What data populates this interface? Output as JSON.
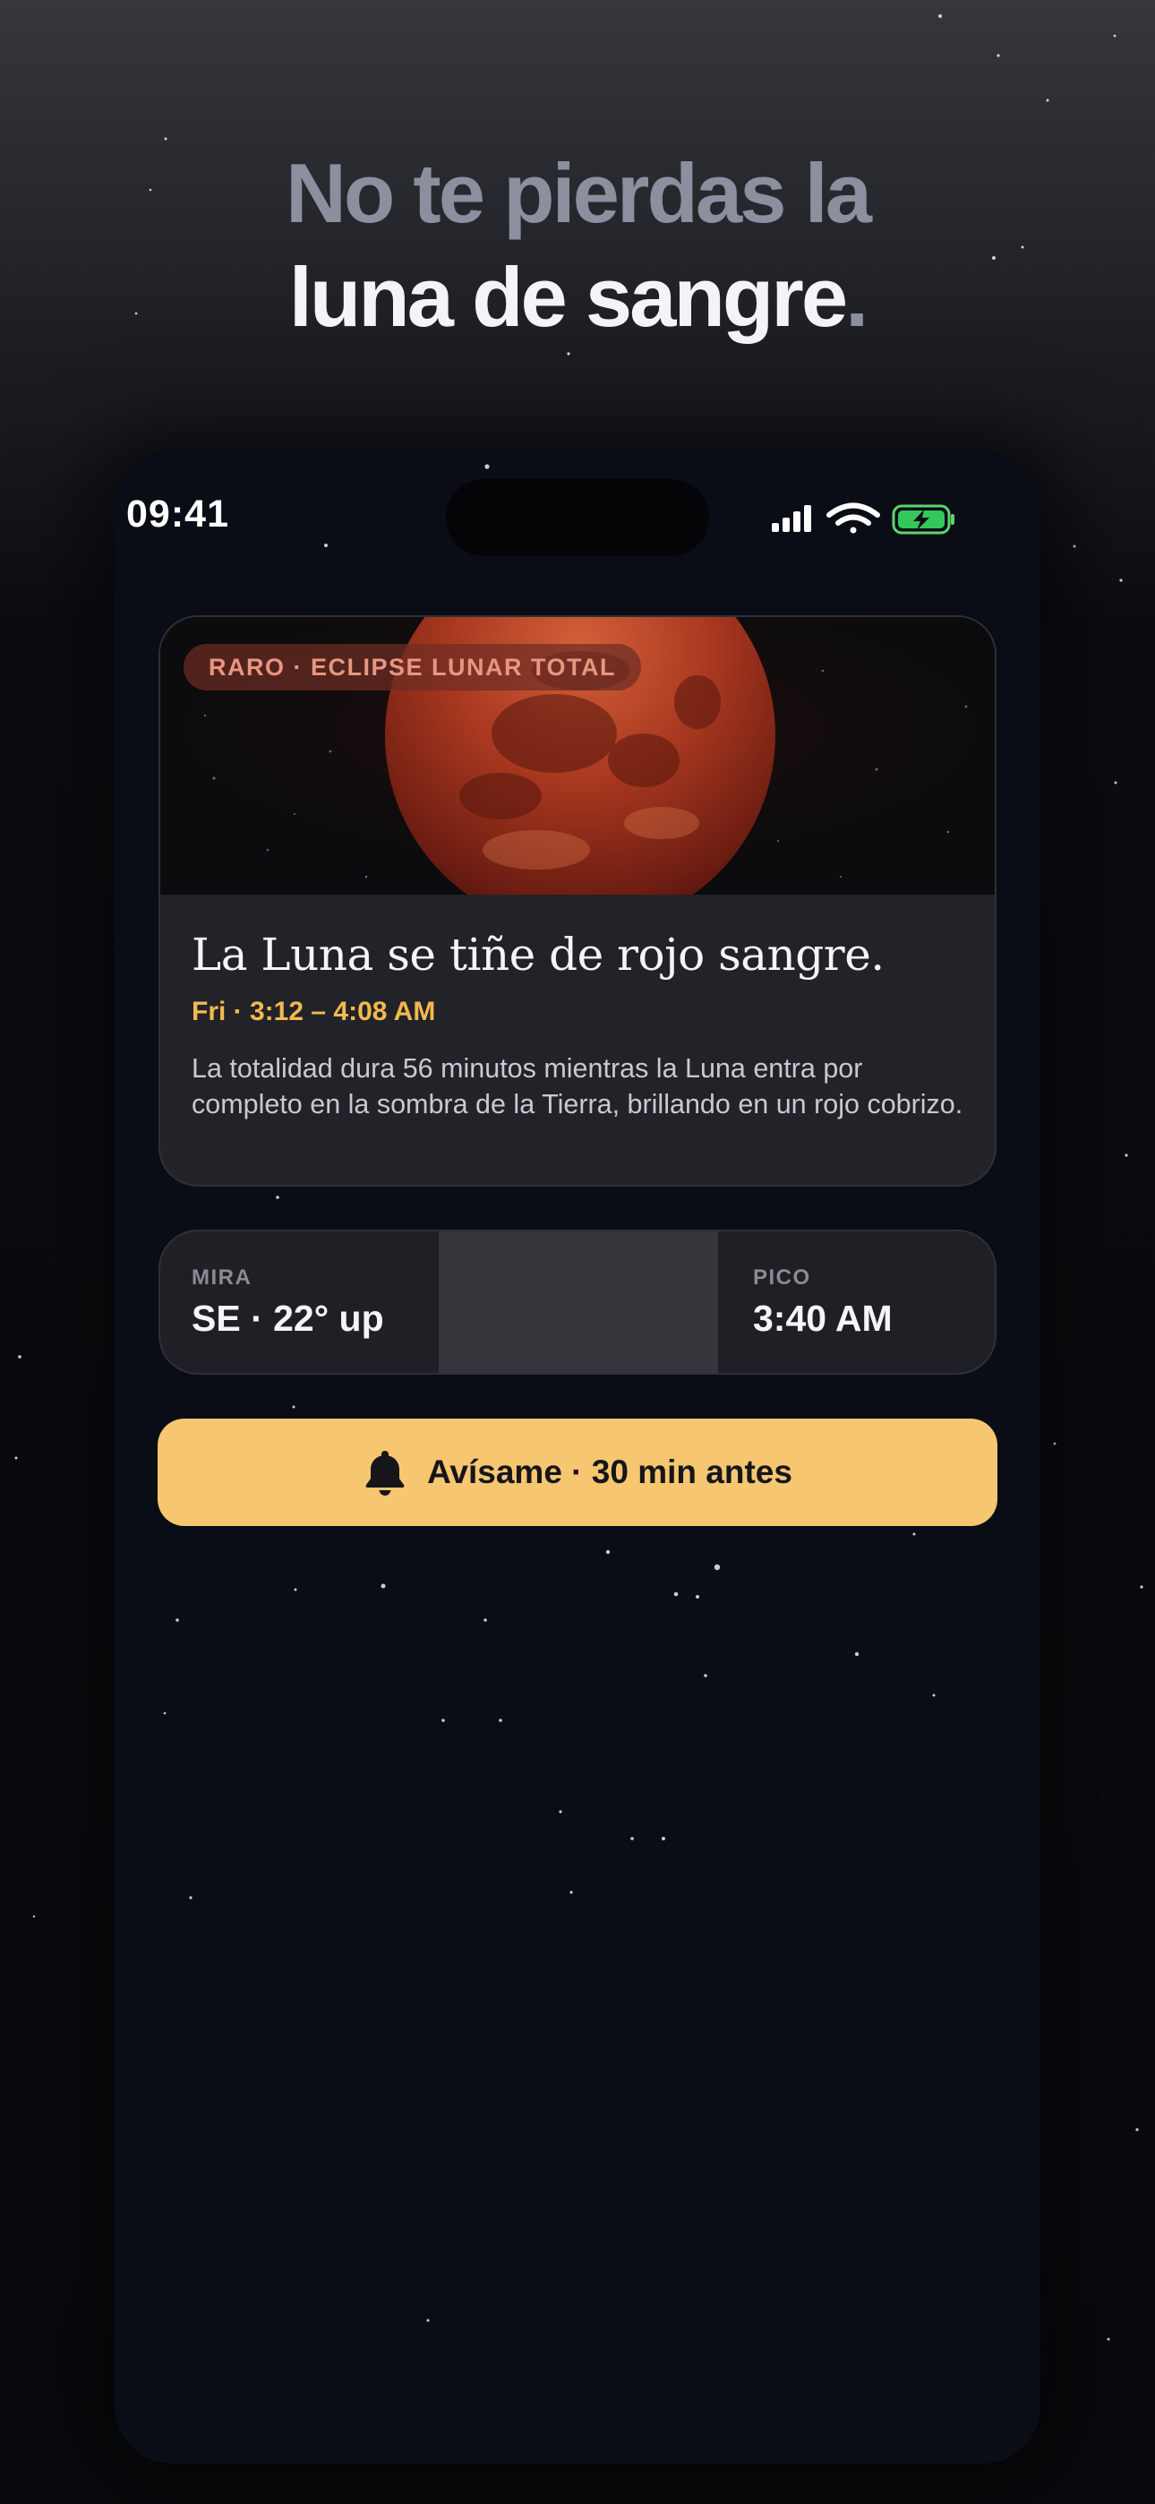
{
  "headline": {
    "line1": "No te pierdas la",
    "line2": "luna de sangre",
    "punctuation": "."
  },
  "status_bar": {
    "time": "09:41",
    "icons": [
      "signal-icon",
      "wifi-icon",
      "battery-charging-icon"
    ]
  },
  "event_card": {
    "badge": "RARO · ECLIPSE LUNAR TOTAL",
    "title": "La Luna se tiñe de rojo sangre.",
    "time": "Fri · 3:12 – 4:08 AM",
    "description": "La totalidad dura 56 minutos mientras la Luna entra por completo en la sombra de la Tierra, brillando en un rojo cobrizo."
  },
  "stats": {
    "look": {
      "label": "MIRA",
      "value": "SE · 22° up"
    },
    "peak": {
      "label": "PICO",
      "value": "3:40 AM"
    }
  },
  "cta": {
    "icon": "bell-icon",
    "label": "Avísame · 30 min antes"
  },
  "colors": {
    "accent": "#f6c670",
    "time_accent": "#f3b94e",
    "badge_text": "#e89680",
    "phone_bg": "#0a0c16",
    "card_bg": "#222329"
  }
}
